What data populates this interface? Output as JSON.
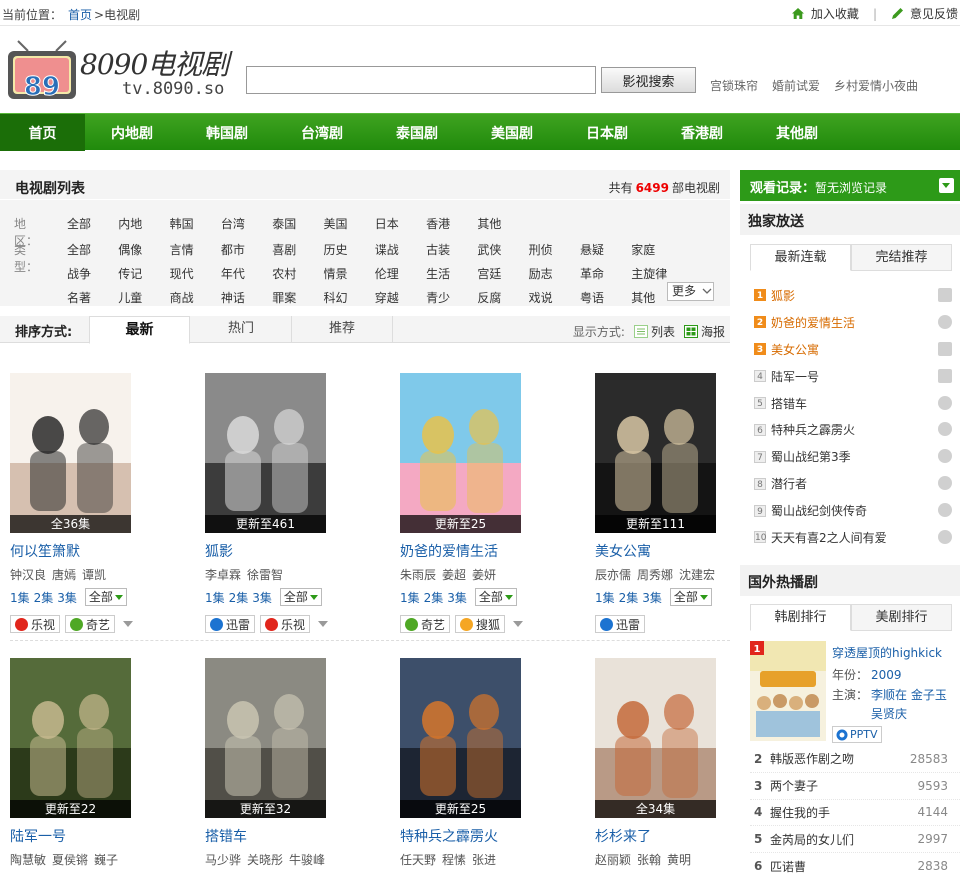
{
  "topbar": {
    "location_label": "当前位置：",
    "crumb_home": "首页",
    "crumb_sep": ">",
    "crumb_current": "电视剧",
    "favorite_label": "加入收藏",
    "separator": "|",
    "feedback_label": "意见反馈"
  },
  "header": {
    "logo_digits": "89",
    "logo_text": "8090电视剧",
    "logo_url": "tv.8090.so",
    "search_value": "",
    "search_button": "影视搜索",
    "hotwords": [
      "宫锁珠帘",
      "婚前试爱",
      "乡村爱情小夜曲"
    ]
  },
  "nav": {
    "items": [
      "首页",
      "内地剧",
      "韩国剧",
      "台湾剧",
      "泰国剧",
      "美国剧",
      "日本剧",
      "香港剧",
      "其他剧"
    ],
    "active_index": 0
  },
  "filter": {
    "title": "电视剧列表",
    "count_prefix": "共有",
    "count": "6499",
    "count_suffix": "部电视剧",
    "region_label": "地区：",
    "regions": [
      "全部",
      "内地",
      "韩国",
      "台湾",
      "泰国",
      "美国",
      "日本",
      "香港",
      "其他"
    ],
    "type_label": "类型：",
    "types": [
      "全部",
      "偶像",
      "言情",
      "都市",
      "喜剧",
      "历史",
      "谍战",
      "古装",
      "武侠",
      "刑侦",
      "悬疑",
      "家庭",
      "战争",
      "传记",
      "现代",
      "年代",
      "农村",
      "情景",
      "伦理",
      "生活",
      "宫廷",
      "励志",
      "革命",
      "主旋律",
      "名著",
      "儿童",
      "商战",
      "神话",
      "罪案",
      "科幻",
      "穿越",
      "青少",
      "反腐",
      "戏说",
      "粤语",
      "其他"
    ],
    "more_label": "更多"
  },
  "sort": {
    "label": "排序方式:",
    "tabs": [
      "最新",
      "热门",
      "推荐"
    ],
    "active_index": 0,
    "display_label": "显示方式:",
    "list_label": "列表",
    "poster_label": "海报"
  },
  "shows": [
    {
      "title": "何以笙箫默",
      "status": "全36集",
      "actors": [
        "钟汉良",
        "唐嫣",
        "谭凯"
      ],
      "eps": [
        "1集",
        "2集",
        "3集"
      ],
      "all_label": "全部",
      "sources": [
        {
          "name": "乐视",
          "color": "#e1261c"
        },
        {
          "name": "奇艺",
          "color": "#4fa825"
        }
      ],
      "more_sources": true
    },
    {
      "title": "狐影",
      "status": "更新至461",
      "actors": [
        "李卓霖",
        "徐雷智"
      ],
      "eps": [
        "1集",
        "2集",
        "3集"
      ],
      "all_label": "全部",
      "sources": [
        {
          "name": "迅雷",
          "color": "#1c73d1"
        },
        {
          "name": "乐视",
          "color": "#e1261c"
        }
      ],
      "more_sources": true
    },
    {
      "title": "奶爸的爱情生活",
      "status": "更新至25",
      "actors": [
        "朱雨辰",
        "姜超",
        "姜妍"
      ],
      "eps": [
        "1集",
        "2集",
        "3集"
      ],
      "all_label": "全部",
      "sources": [
        {
          "name": "奇艺",
          "color": "#4fa825"
        },
        {
          "name": "搜狐",
          "color": "#f5a623"
        }
      ],
      "more_sources": true
    },
    {
      "title": "美女公寓",
      "status": "更新至111",
      "actors": [
        "辰亦儒",
        "周秀娜",
        "沈建宏"
      ],
      "eps": [
        "1集",
        "2集",
        "3集"
      ],
      "all_label": "全部",
      "sources": [
        {
          "name": "迅雷",
          "color": "#1c73d1"
        }
      ],
      "more_sources": false
    },
    {
      "title": "陆军一号",
      "status": "更新至22",
      "actors": [
        "陶慧敏",
        "夏侯锵",
        "巍子"
      ],
      "eps": [],
      "all_label": "",
      "sources": [],
      "more_sources": false
    },
    {
      "title": "搭错车",
      "status": "更新至32",
      "actors": [
        "马少骅",
        "关晓彤",
        "牛骏峰"
      ],
      "eps": [],
      "all_label": "",
      "sources": [],
      "more_sources": false
    },
    {
      "title": "特种兵之霹雳火",
      "status": "更新至25",
      "actors": [
        "任天野",
        "程愫",
        "张进"
      ],
      "eps": [],
      "all_label": "",
      "sources": [],
      "more_sources": false
    },
    {
      "title": "杉杉来了",
      "status": "全34集",
      "actors": [
        "赵丽颖",
        "张翰",
        "黄明"
      ],
      "eps": [],
      "all_label": "",
      "sources": [],
      "more_sources": false
    }
  ],
  "sidebar": {
    "history_label": "观看记录：",
    "history_value": "暂无浏览记录",
    "exclusive_title": "独家放送",
    "exclusive_tabs": [
      "最新连载",
      "完结推荐"
    ],
    "exclusive_list": [
      "狐影",
      "奶爸的爱情生活",
      "美女公寓",
      "陆军一号",
      "搭错车",
      "特种兵之霹雳火",
      "蜀山战纪第3季",
      "潜行者",
      "蜀山战纪剑侠传奇",
      "天天有喜2之人间有爱"
    ],
    "foreign_title": "国外热播剧",
    "foreign_tabs": [
      "韩剧排行",
      "美剧排行"
    ],
    "feature": {
      "rank": "1",
      "title": "穿透屋顶的highkick",
      "year_label": "年份：",
      "year": "2009",
      "cast_label": "主演：",
      "cast_line1": "李顺在 金子玉",
      "cast_line2": "吴贤庆",
      "source": "PPTV"
    },
    "korean_list": [
      {
        "rank": "2",
        "name": "韩版恶作剧之吻",
        "count": "28583"
      },
      {
        "rank": "3",
        "name": "两个妻子",
        "count": "9593"
      },
      {
        "rank": "4",
        "name": "握住我的手",
        "count": "4144"
      },
      {
        "rank": "5",
        "name": "金芮局的女儿们",
        "count": "2997"
      },
      {
        "rank": "6",
        "name": "匹诺曹",
        "count": "2838"
      }
    ]
  },
  "colors": {
    "brand_green": "#2d9a18",
    "link_blue": "#1a5fa8",
    "highlight_red": "#e00000",
    "rank_orange": "#f08c1a"
  }
}
